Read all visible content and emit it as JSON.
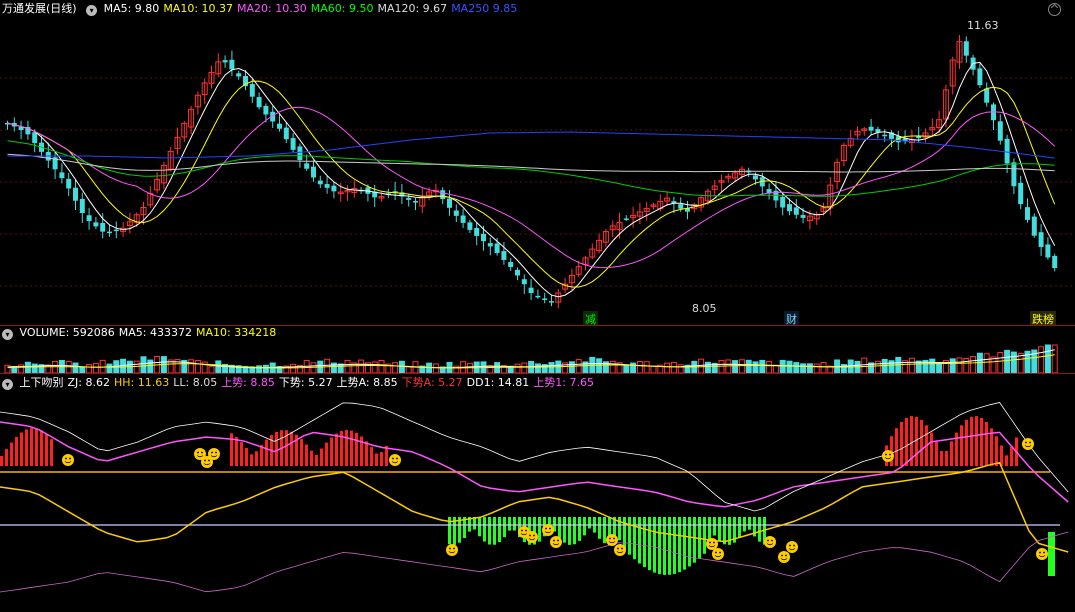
{
  "main_panel": {
    "title": "万通发展(日线)",
    "indicators": [
      {
        "label": "MA5: 9.80",
        "color": "#ffffff"
      },
      {
        "label": "MA10: 10.37",
        "color": "#ffff00"
      },
      {
        "label": "MA20: 10.30",
        "color": "#ff55ff"
      },
      {
        "label": "MA60: 9.50",
        "color": "#00ff00"
      },
      {
        "label": "MA120: 9.67",
        "color": "#dddddd"
      },
      {
        "label": "MA250 9.85",
        "color": "#3355ff"
      }
    ],
    "high_label": "11.63",
    "low_label": "8.05",
    "event_tags": [
      {
        "text": "减",
        "color": "#00ee00"
      },
      {
        "text": "财",
        "color": "#7fd7ff"
      },
      {
        "text": "跌榜",
        "color": "#ffff00"
      }
    ]
  },
  "volume_panel": {
    "indicators": [
      {
        "label": "VOLUME: 592086",
        "color": "#ffffff"
      },
      {
        "label": "MA5: 433372",
        "color": "#ffffff"
      },
      {
        "label": "MA10: 334218",
        "color": "#ffff00"
      }
    ]
  },
  "indicator_panel": {
    "indicators": [
      {
        "label": "上下吻别",
        "color": "#ffffff"
      },
      {
        "label": "ZJ: 8.62",
        "color": "#ffffff"
      },
      {
        "label": "HH: 11.63",
        "color": "#ffcc00"
      },
      {
        "label": "LL: 8.05",
        "color": "#dddddd"
      },
      {
        "label": "上势: 8.85",
        "color": "#ff55ff"
      },
      {
        "label": "下势: 5.27",
        "color": "#ffffff"
      },
      {
        "label": "上势A: 8.85",
        "color": "#ffffff"
      },
      {
        "label": "下势A: 5.27",
        "color": "#ff3333"
      },
      {
        "label": "DD1: 14.81",
        "color": "#ffffff"
      },
      {
        "label": "上势1: 7.65",
        "color": "#ff55ff"
      }
    ]
  },
  "chart_data": {
    "type": "candlestick",
    "high": 11.63,
    "low": 8.05,
    "last_close_approx": 8.6,
    "series": [
      {
        "name": "MA5",
        "last": 9.8
      },
      {
        "name": "MA10",
        "last": 10.37
      },
      {
        "name": "MA20",
        "last": 10.3
      },
      {
        "name": "MA60",
        "last": 9.5
      },
      {
        "name": "MA120",
        "last": 9.67
      },
      {
        "name": "MA250",
        "last": 9.85
      }
    ]
  }
}
